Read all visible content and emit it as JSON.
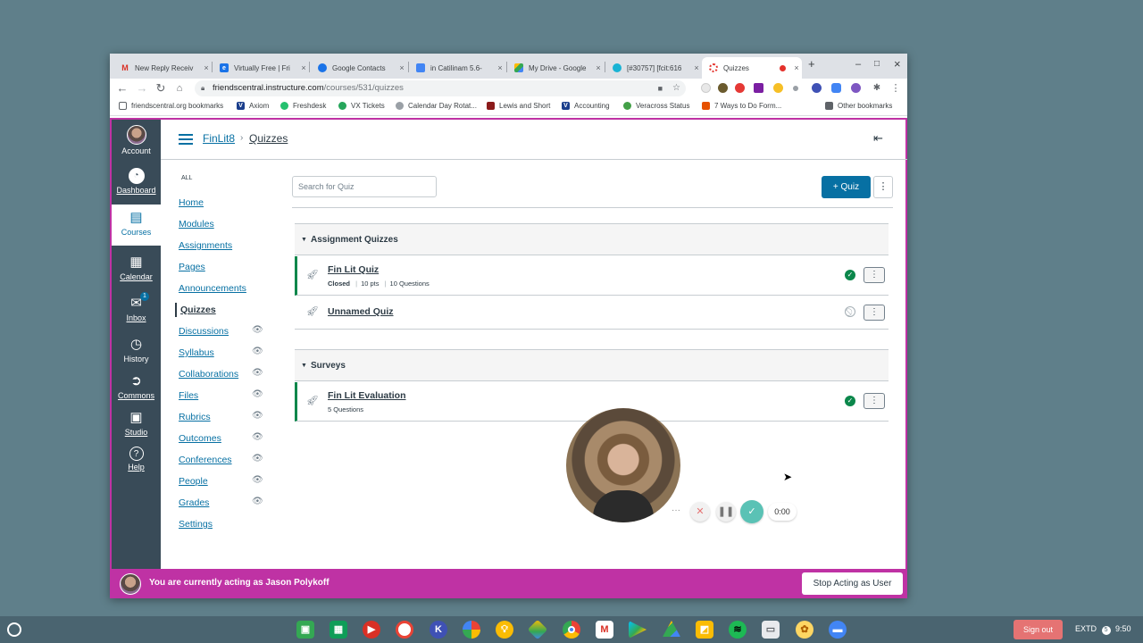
{
  "tabs": [
    {
      "title": "New Reply Receiv",
      "icon": "gmail-icon",
      "color": "#d93025"
    },
    {
      "title": "Virtually Free | Fri",
      "icon": "edge-icon",
      "color": "#1a73e8"
    },
    {
      "title": "Google Contacts",
      "icon": "contacts-icon",
      "color": "#1a73e8"
    },
    {
      "title": "in Catilinam 5.6-",
      "icon": "docs-icon",
      "color": "#4285f4"
    },
    {
      "title": "My Drive - Google",
      "icon": "drive-icon",
      "color": "#34a853"
    },
    {
      "title": "[#30757] [fcit:616",
      "icon": "ticket-icon",
      "color": "#19b3d4"
    },
    {
      "title": "Quizzes",
      "icon": "canvas-icon",
      "color": "#e4312b"
    }
  ],
  "window_controls": {
    "new_tab": "+",
    "minimize": "–",
    "maximize": "□",
    "close": "×"
  },
  "url": {
    "host": "friendscentral.instructure.com",
    "path": "/courses/531/quizzes"
  },
  "bookmarks": [
    {
      "label": "friendscentral.org bookmarks",
      "color": "#5f6368"
    },
    {
      "label": "Axiom",
      "color": "#1a3e8c"
    },
    {
      "label": "Freshdesk",
      "color": "#25c16f"
    },
    {
      "label": "VX Tickets",
      "color": "#26a65b"
    },
    {
      "label": "Calendar Day Rotat...",
      "color": "#9aa0a6"
    },
    {
      "label": "Lewis and Short",
      "color": "#8b1a1a"
    },
    {
      "label": "Accounting",
      "color": "#1a3e8c"
    },
    {
      "label": "Veracross Status",
      "color": "#43a047"
    },
    {
      "label": "7 Ways to Do Form...",
      "color": "#e65100"
    }
  ],
  "other_bookmarks": "Other bookmarks",
  "global_nav": [
    {
      "label": "Account",
      "icon": "account-avatar-icon"
    },
    {
      "label": "Dashboard",
      "icon": "dashboard-icon"
    },
    {
      "label": "Courses",
      "icon": "courses-icon"
    },
    {
      "label": "Calendar",
      "icon": "calendar-icon"
    },
    {
      "label": "Inbox",
      "icon": "inbox-icon",
      "badge": "1"
    },
    {
      "label": "History",
      "icon": "history-icon"
    },
    {
      "label": "Commons",
      "icon": "commons-icon"
    },
    {
      "label": "Studio",
      "icon": "studio-icon"
    },
    {
      "label": "Help",
      "icon": "help-icon"
    }
  ],
  "breadcrumb": {
    "course": "FinLit8",
    "page": "Quizzes"
  },
  "course_nav": {
    "all_label": "ALL",
    "items": [
      {
        "label": "Home"
      },
      {
        "label": "Modules"
      },
      {
        "label": "Assignments"
      },
      {
        "label": "Pages"
      },
      {
        "label": "Announcements"
      },
      {
        "label": "Quizzes",
        "active": true
      },
      {
        "label": "Discussions",
        "hidden": true
      },
      {
        "label": "Syllabus",
        "hidden": true
      },
      {
        "label": "Collaborations",
        "hidden": true
      },
      {
        "label": "Files",
        "hidden": true
      },
      {
        "label": "Rubrics",
        "hidden": true
      },
      {
        "label": "Outcomes",
        "hidden": true
      },
      {
        "label": "Conferences",
        "hidden": true
      },
      {
        "label": "People",
        "hidden": true
      },
      {
        "label": "Grades",
        "hidden": true
      },
      {
        "label": "Settings"
      }
    ]
  },
  "search": {
    "placeholder": "Search for Quiz"
  },
  "add_quiz_label": "+ Quiz",
  "groups": [
    {
      "title": "Assignment Quizzes",
      "quizzes": [
        {
          "title": "Fin Lit Quiz",
          "status": "Closed",
          "points": "10 pts",
          "questions": "10 Questions",
          "published": true
        },
        {
          "title": "Unnamed Quiz",
          "published": false
        }
      ]
    },
    {
      "title": "Surveys",
      "quizzes": [
        {
          "title": "Fin Lit Evaluation",
          "questions": "5 Questions",
          "published": true
        }
      ]
    }
  ],
  "acting_as": {
    "message": "You are currently acting as Jason Polykoff",
    "stop_label": "Stop Acting as User"
  },
  "recorder": {
    "timer": "0:00"
  },
  "shelf": {
    "apps": [
      "classroom-icon",
      "sheets-icon",
      "screencast-icon",
      "camera-icon",
      "kami-icon",
      "photos-icon",
      "keep-icon",
      "gallery-icon",
      "chrome-icon",
      "gmail-icon",
      "play-store-icon",
      "drive-icon",
      "keep-notes-icon",
      "spotify-icon",
      "files-icon",
      "settings-icon",
      "screen-recorder-icon"
    ],
    "sign_out": "Sign out",
    "ime": "EXTD",
    "notification_count": "5",
    "time": "9:50"
  },
  "colors": {
    "canvas_blue": "#0770a3",
    "published_green": "#0b874b",
    "masquerade_magenta": "#bf32a4",
    "global_nav": "#394b58"
  }
}
